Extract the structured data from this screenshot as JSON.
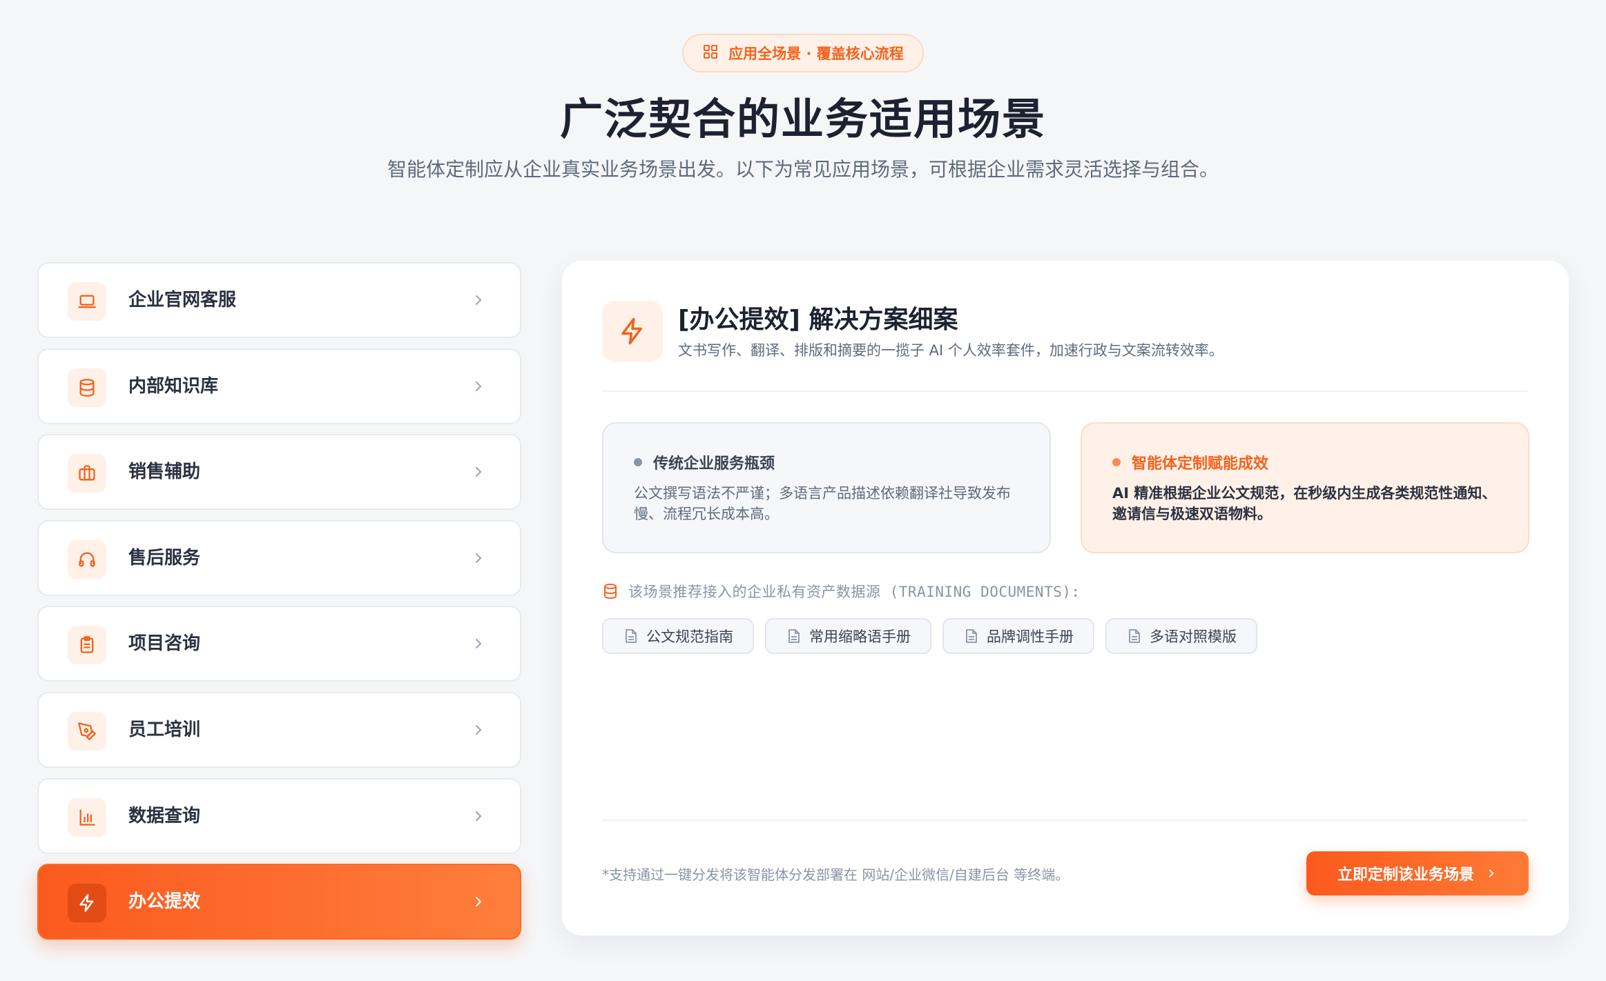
{
  "badge": {
    "icon": "grid-icon",
    "label": "应用全场景 · 覆盖核心流程"
  },
  "header": {
    "title": "广泛契合的业务适用场景",
    "subtitle": "智能体定制应从企业真实业务场景出发。以下为常见应用场景，可根据企业需求灵活选择与组合。"
  },
  "sidebar": {
    "items": [
      {
        "label": "企业官网客服",
        "icon": "laptop-icon",
        "active": false
      },
      {
        "label": "内部知识库",
        "icon": "database-icon",
        "active": false
      },
      {
        "label": "销售辅助",
        "icon": "briefcase-icon",
        "active": false
      },
      {
        "label": "售后服务",
        "icon": "headphones-icon",
        "active": false
      },
      {
        "label": "项目咨询",
        "icon": "clipboard-icon",
        "active": false
      },
      {
        "label": "员工培训",
        "icon": "pen-tool-icon",
        "active": false
      },
      {
        "label": "数据查询",
        "icon": "bar-chart-icon",
        "active": false
      },
      {
        "label": "办公提效",
        "icon": "lightning-icon",
        "active": true
      }
    ]
  },
  "detail": {
    "icon": "lightning-icon",
    "title": "[办公提效] 解决方案细案",
    "description": "文书写作、翻译、排版和摘要的一揽子 AI 个人效率套件，加速行政与文案流转效率。",
    "pain": {
      "title": "传统企业服务瓶颈",
      "text": "公文撰写语法不严谨；多语言产品描述依赖翻译社导致发布慢、流程冗长成本高。"
    },
    "gain": {
      "title": "智能体定制赋能成效",
      "text": "AI 精准根据企业公文规范，在秒级内生成各类规范性通知、邀请信与极速双语物料。"
    },
    "sources_label": "该场景推荐接入的企业私有资产数据源 (TRAINING DOCUMENTS):",
    "documents": [
      "公文规范指南",
      "常用缩略语手册",
      "品牌调性手册",
      "多语对照模版"
    ],
    "footnote": "*支持通过一键分发将该智能体分发部署在 网站/企业微信/自建后台 等终端。",
    "cta_label": "立即定制该业务场景"
  },
  "colors": {
    "accent": "#f4621c",
    "accent_light": "#fff1e8",
    "background": "#f5f6f8",
    "text_dark": "#1c2230",
    "text_muted": "#5f6b7c"
  }
}
